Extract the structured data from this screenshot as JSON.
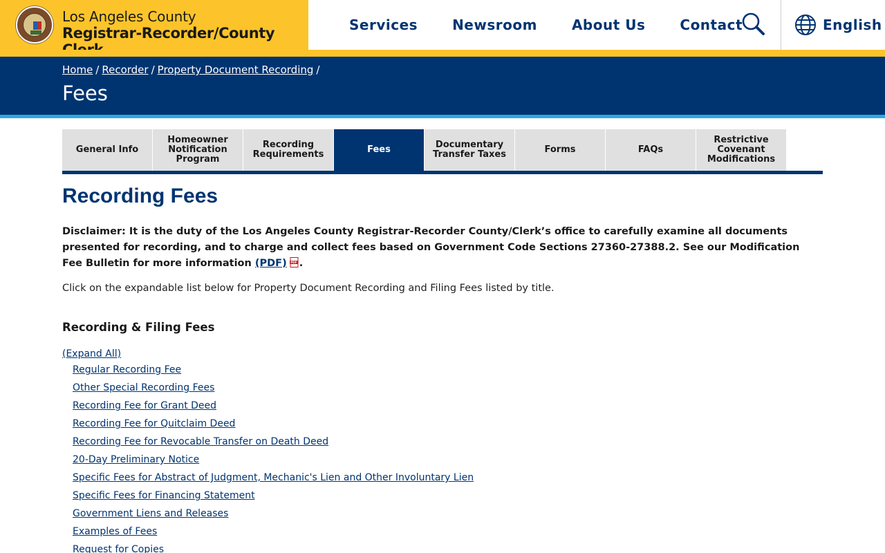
{
  "header": {
    "agency_line1": "Los Angeles County",
    "agency_line2": "Registrar-Recorder/County Clerk",
    "nav": [
      "Services",
      "Newsroom",
      "About Us",
      "Contact"
    ],
    "language_label": "English"
  },
  "colors": {
    "brand_gold": "#fcc42a",
    "navy": "#003471",
    "accent_blue": "#2ea8e0",
    "tab_gray": "#e0e0e0"
  },
  "banner": {
    "breadcrumb": [
      "Home",
      "Recorder",
      "Property Document Recording"
    ],
    "breadcrumb_separator": "/",
    "title": "Fees"
  },
  "tabs": [
    {
      "label": "General Info",
      "active": false
    },
    {
      "label": "Homeowner Notification Program",
      "active": false
    },
    {
      "label": "Recording Requirements",
      "active": false
    },
    {
      "label": "Fees",
      "active": true
    },
    {
      "label": "Documentary Transfer Taxes",
      "active": false
    },
    {
      "label": "Forms",
      "active": false
    },
    {
      "label": "FAQs",
      "active": false
    },
    {
      "label": "Restrictive Covenant Modifications",
      "active": false
    }
  ],
  "main": {
    "heading": "Recording Fees",
    "disclaimer_text": "Disclaimer: It is the duty of the Los Angeles County Registrar-Recorder County/Clerk’s office to carefully examine all documents presented for recording, and to charge and collect fees based on Government Code Sections 27360-27388.2. See our Modification Fee Bulletin for more information",
    "disclaimer_link": "(PDF)",
    "disclaimer_end": ".",
    "intro": "Click on the expandable list below for Property Document Recording and Filing Fees listed by title.",
    "section_heading": "Recording & Filing Fees",
    "expand_all": "(Expand All)",
    "fee_links": [
      "Regular Recording Fee",
      "Other Special Recording Fees",
      "Recording Fee for Grant Deed",
      "Recording Fee for Quitclaim Deed",
      "Recording Fee for Revocable Transfer on Death Deed",
      "20-Day Preliminary Notice",
      "Specific Fees for Abstract of Judgment, Mechanic's Lien and Other Involuntary Lien",
      "Specific Fees for Financing Statement",
      "Government Liens and Releases",
      "Examples of Fees",
      "Request for Copies"
    ]
  }
}
